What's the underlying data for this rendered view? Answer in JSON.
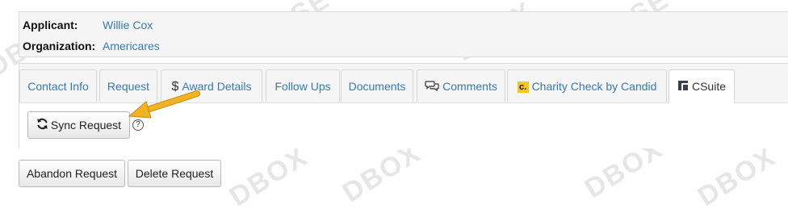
{
  "applicant": {
    "label": "Applicant:",
    "value": "Willie Cox"
  },
  "organization": {
    "label": "Organization:",
    "value": "Americares"
  },
  "tabs": [
    {
      "label": "Contact Info"
    },
    {
      "label": "Request"
    },
    {
      "label": "Award Details",
      "icon": "dollar-icon"
    },
    {
      "label": "Follow Ups"
    },
    {
      "label": "Documents"
    },
    {
      "label": "Comments",
      "icon": "comments-icon"
    },
    {
      "label": "Charity Check by Candid",
      "icon": "candid-c-icon"
    },
    {
      "label": "CSuite",
      "icon": "csuite-icon",
      "active": true
    }
  ],
  "content": {
    "sync_label": "Sync Request",
    "help_glyph": "?"
  },
  "actions": {
    "abandon_label": "Abandon Request",
    "delete_label": "Delete Request"
  },
  "colors": {
    "link": "#337ab7",
    "arrow": "#f0b323",
    "candid_badge": "#f5c518"
  }
}
